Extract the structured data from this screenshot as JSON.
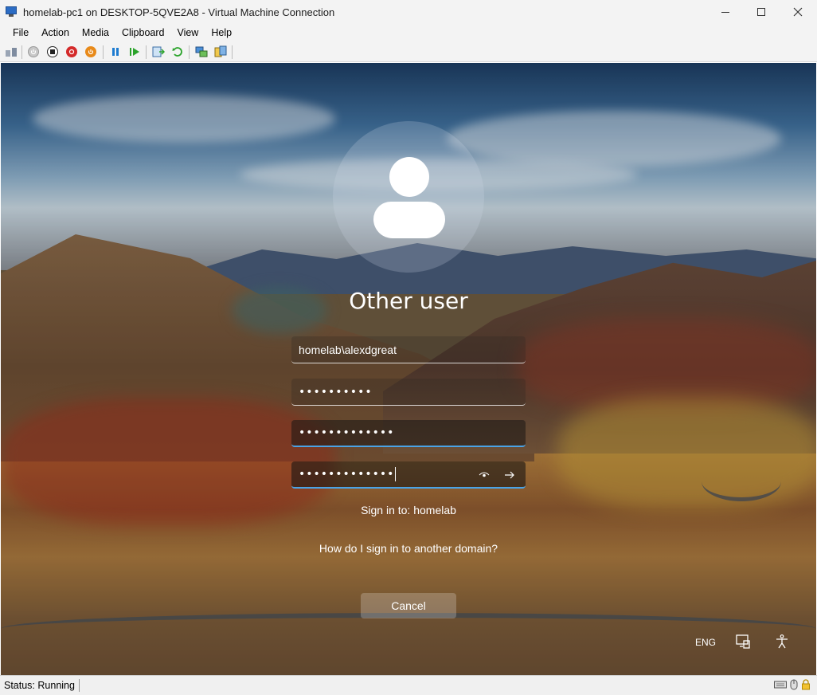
{
  "window": {
    "title": "homelab-pc1 on DESKTOP-5QVE2A8 - Virtual Machine Connection",
    "app_icon": "vm-connection-icon"
  },
  "menu": {
    "items": [
      "File",
      "Action",
      "Media",
      "Clipboard",
      "View",
      "Help"
    ]
  },
  "toolbar": {
    "buttons": [
      "ctrl-alt-del-icon",
      "start-icon",
      "turn-off-icon",
      "shutdown-icon",
      "save-icon",
      "pause-icon",
      "resume-icon",
      "checkpoint-icon",
      "revert-icon",
      "enhanced-session-icon",
      "share-icon"
    ]
  },
  "login": {
    "title": "Other user",
    "username": "homelab\\alexdgreat",
    "password_mask": "••••••••••",
    "new_password_mask": "•••••••••••••",
    "confirm_password_mask": "•••••••••••••",
    "sign_in_to": "Sign in to: homelab",
    "other_domain_link": "How do I sign in to another domain?",
    "cancel_label": "Cancel"
  },
  "tray": {
    "language": "ENG"
  },
  "status": {
    "text": "Status: Running"
  },
  "colors": {
    "focus_accent": "#4aa3e6",
    "chrome": "#f3f3f3"
  }
}
